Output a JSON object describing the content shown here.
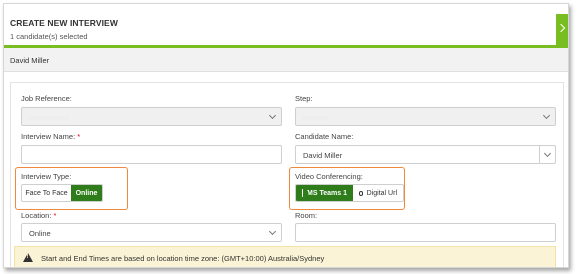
{
  "header": {
    "title": "CREATE NEW INTERVIEW",
    "subtitle": "1 candidate(s) selected"
  },
  "candidate": {
    "name": "David Miller"
  },
  "form": {
    "job_reference": {
      "label": "Job Reference:",
      "value": ""
    },
    "step": {
      "label": "Step:",
      "value": ""
    },
    "interview_name": {
      "label": "Interview Name:",
      "required_mark": "*",
      "value": ""
    },
    "candidate_name": {
      "label": "Candidate Name:",
      "value": "David Miller"
    },
    "interview_type": {
      "label": "Interview Type:",
      "options": [
        "Face To Face",
        "Online"
      ],
      "selected": "Online"
    },
    "video_conferencing": {
      "label": "Video Conferencing:",
      "options": [
        {
          "label": "MS Teams 1",
          "icon": "ms-teams-icon",
          "selected": true
        },
        {
          "label": "Digital Url",
          "icon": "link-icon",
          "selected": false
        }
      ]
    },
    "location": {
      "label": "Location:",
      "required_mark": "*",
      "value": "Online"
    },
    "room": {
      "label": "Room:",
      "value": ""
    }
  },
  "notice": {
    "icon": "warning-icon",
    "text": "Start and End Times are based on location time zone: (GMT+10:00) Australia/Sydney"
  },
  "colors": {
    "accent_green": "#78be20",
    "active_green": "#2e7d1a",
    "highlight_orange": "#f0883e",
    "notice_bg": "#fbf3d5"
  }
}
